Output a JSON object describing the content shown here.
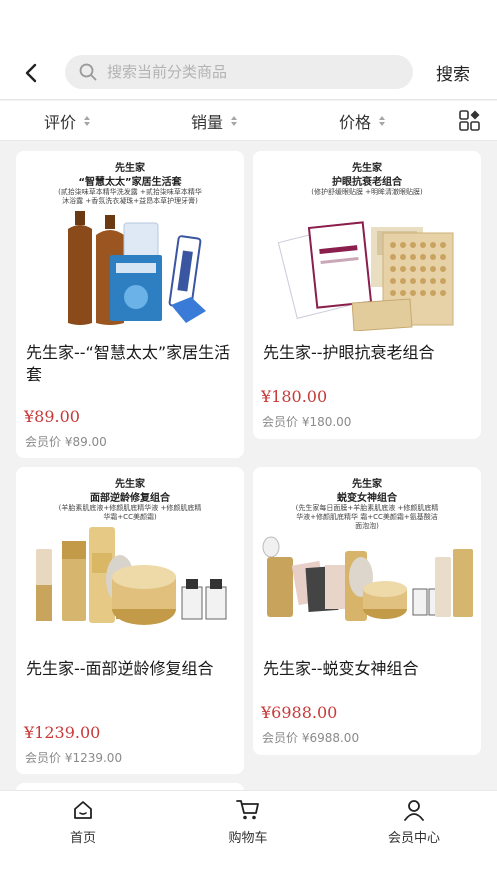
{
  "header": {
    "search_placeholder": "搜索当前分类商品",
    "search_button": "搜索"
  },
  "filter": {
    "sort_rating": "评价",
    "sort_sales": "销量",
    "sort_price": "价格"
  },
  "products": [
    {
      "img_line1": "先生家",
      "img_line2": "“智慧太太”家居生活套",
      "img_line3": "(贰拾柒味草本精华洗发露 +贰拾柒味草本精华沐浴露 +香氛洗衣凝珠+益昂本草护理牙膏)",
      "name": "先生家--“智慧太太”家居生活套",
      "price": "¥89.00",
      "member_price": "会员价 ¥89.00"
    },
    {
      "img_line1": "先生家",
      "img_line2": "护眼抗衰老组合",
      "img_line3": "(修护舒缓眼贴膜 +明眸清澈眼贴膜)",
      "name": "先生家--护眼抗衰老组合",
      "price": "¥180.00",
      "member_price": "会员价 ¥180.00"
    },
    {
      "img_line1": "先生家",
      "img_line2": "面部逆龄修复组合",
      "img_line3": "(羊胎素肌底液+修颜肌底精华液 +修颜肌底精华霜+CC美颜霜)",
      "name": "先生家--面部逆龄修复组合",
      "price": "¥1239.00",
      "member_price": "会员价 ¥1239.00"
    },
    {
      "img_line1": "先生家",
      "img_line2": "蜕变女神组合",
      "img_line3": "(先生家每日面膜+羊胎素肌底液 +修颜肌底精华液+修颜肌底精华 霜+CC美颜霜+氨基酸洁面泡泡)",
      "name": "先生家--蜕变女神组合",
      "price": "¥6988.00",
      "member_price": "会员价 ¥6988.00"
    }
  ],
  "tabbar": {
    "home": "首页",
    "cart": "购物车",
    "member": "会员中心"
  },
  "colors": {
    "price": "#c83a3a",
    "background": "#f2f2f2",
    "gold": "#c9a45c"
  }
}
